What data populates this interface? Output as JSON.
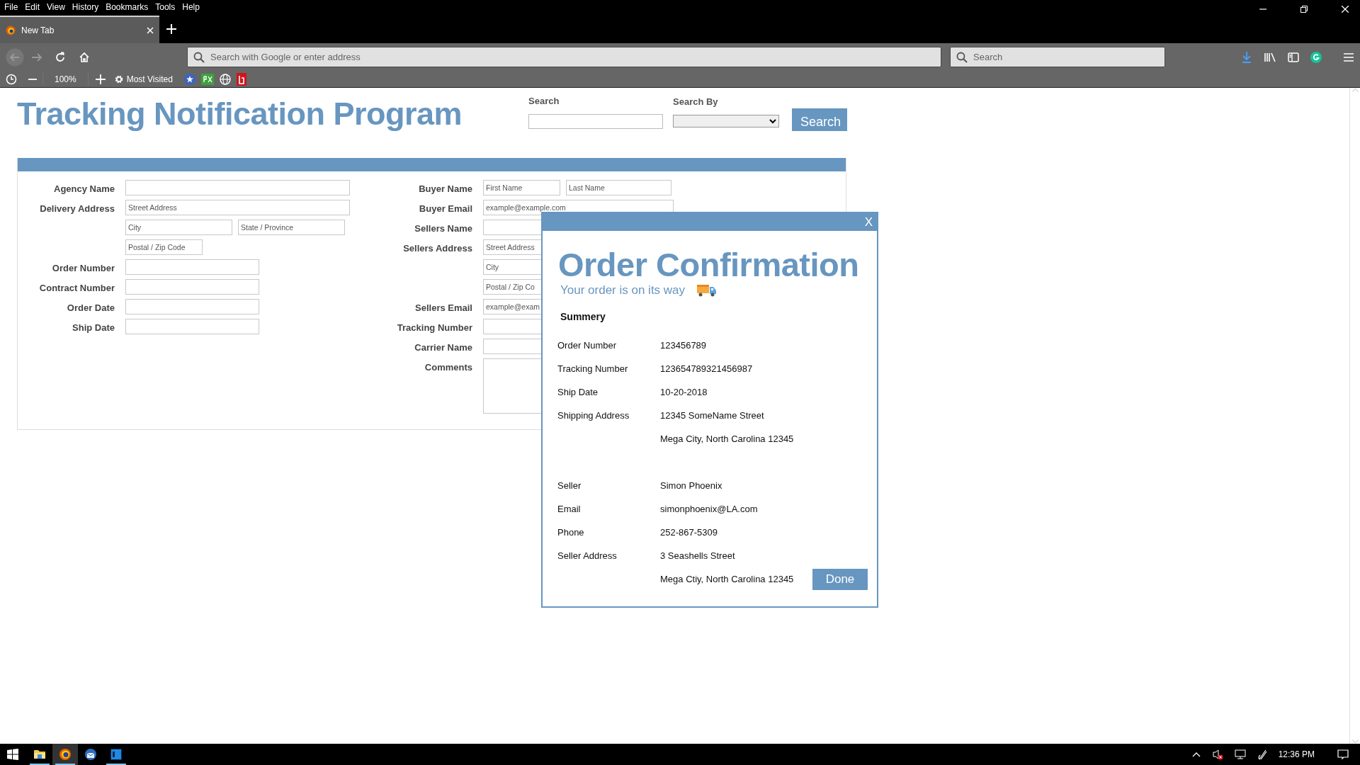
{
  "menu_bar": [
    "File",
    "Edit",
    "View",
    "History",
    "Bookmarks",
    "Tools",
    "Help"
  ],
  "tabs": [
    {
      "label": "New Tab",
      "selected": true
    }
  ],
  "address_bar": {
    "placeholder": "Search with Google or enter address"
  },
  "search_bar": {
    "placeholder": "Search"
  },
  "bookmarks_bar": {
    "zoom": "100%",
    "folder": "Most Visited"
  },
  "page": {
    "title": "Tracking Notification Program",
    "search_label": "Search",
    "search_by_label": "Search By",
    "search_button": "Search"
  },
  "form": {
    "left": [
      {
        "label": "Agency Name",
        "fields": [
          {
            "kind": "input"
          }
        ]
      },
      {
        "label": "Delivery Address",
        "fields": [
          {
            "kind": "input",
            "placeholder": "Street Address"
          }
        ]
      },
      {
        "fields": [
          {
            "kind": "input",
            "placeholder": "City"
          },
          {
            "kind": "input",
            "placeholder": "State / Province"
          }
        ]
      },
      {
        "fields": [
          {
            "kind": "input",
            "placeholder": "Postal / Zip Code"
          }
        ]
      },
      {
        "label": "Order Number",
        "fields": [
          {
            "kind": "input"
          }
        ]
      },
      {
        "label": "Contract Number",
        "fields": [
          {
            "kind": "input"
          }
        ]
      },
      {
        "label": "Order Date",
        "fields": [
          {
            "kind": "input"
          }
        ]
      },
      {
        "label": "Ship Date",
        "fields": [
          {
            "kind": "input"
          }
        ]
      }
    ],
    "right": [
      {
        "label": "Buyer Name",
        "fields": [
          {
            "kind": "input",
            "placeholder": "First Name"
          },
          {
            "kind": "input",
            "placeholder": "Last Name"
          }
        ]
      },
      {
        "label": "Buyer Email",
        "fields": [
          {
            "kind": "input",
            "placeholder": "example@example.com"
          }
        ]
      },
      {
        "label": "Sellers Name",
        "fields": [
          {
            "kind": "input"
          }
        ]
      },
      {
        "label": "Sellers Address",
        "fields": [
          {
            "kind": "input",
            "placeholder": "Street Address"
          }
        ]
      },
      {
        "fields": [
          {
            "kind": "input",
            "placeholder": "City"
          }
        ]
      },
      {
        "fields": [
          {
            "kind": "input",
            "placeholder": "Postal / Zip Co"
          }
        ]
      },
      {
        "label": "Sellers Email",
        "fields": [
          {
            "kind": "input",
            "placeholder": "example@exam"
          }
        ]
      },
      {
        "label": "Tracking Number",
        "fields": [
          {
            "kind": "input"
          }
        ]
      },
      {
        "label": "Carrier Name",
        "fields": [
          {
            "kind": "input"
          }
        ]
      },
      {
        "label": "Comments",
        "fields": [
          {
            "kind": "textarea"
          }
        ]
      }
    ]
  },
  "dialog": {
    "close": "X",
    "title": "Order Confirmation",
    "subtitle": "Your order is on its way",
    "section_title": "Summery",
    "sections": [
      [
        {
          "label": "Order Number",
          "value": "123456789"
        },
        {
          "label": "Tracking Number",
          "value": "123654789321456987"
        },
        {
          "label": "Ship Date",
          "value": "10-20-2018"
        },
        {
          "label": "Shipping Address",
          "value": "12345 SomeName Street"
        },
        {
          "value": "Mega City, North Carolina 12345"
        }
      ],
      [
        {
          "label": "Seller",
          "value": "Simon Phoenix"
        },
        {
          "label": "Email",
          "value": "simonphoenix@LA.com"
        },
        {
          "label": "Phone",
          "value": "252-867-5309"
        },
        {
          "label": "Seller Address",
          "value": "3 Seashells Street"
        },
        {
          "value": "Mega Ctiy, North Carolina 12345"
        }
      ]
    ],
    "done_button": "Done"
  },
  "taskbar": {
    "apps": [
      {
        "kind": "folder",
        "open": true,
        "selected": false
      },
      {
        "kind": "firefox",
        "open": true,
        "selected": true
      },
      {
        "kind": "mail",
        "open": false,
        "selected": false
      },
      {
        "kind": "photoshop",
        "open": true,
        "selected": false
      }
    ],
    "time": "12:36 PM"
  }
}
